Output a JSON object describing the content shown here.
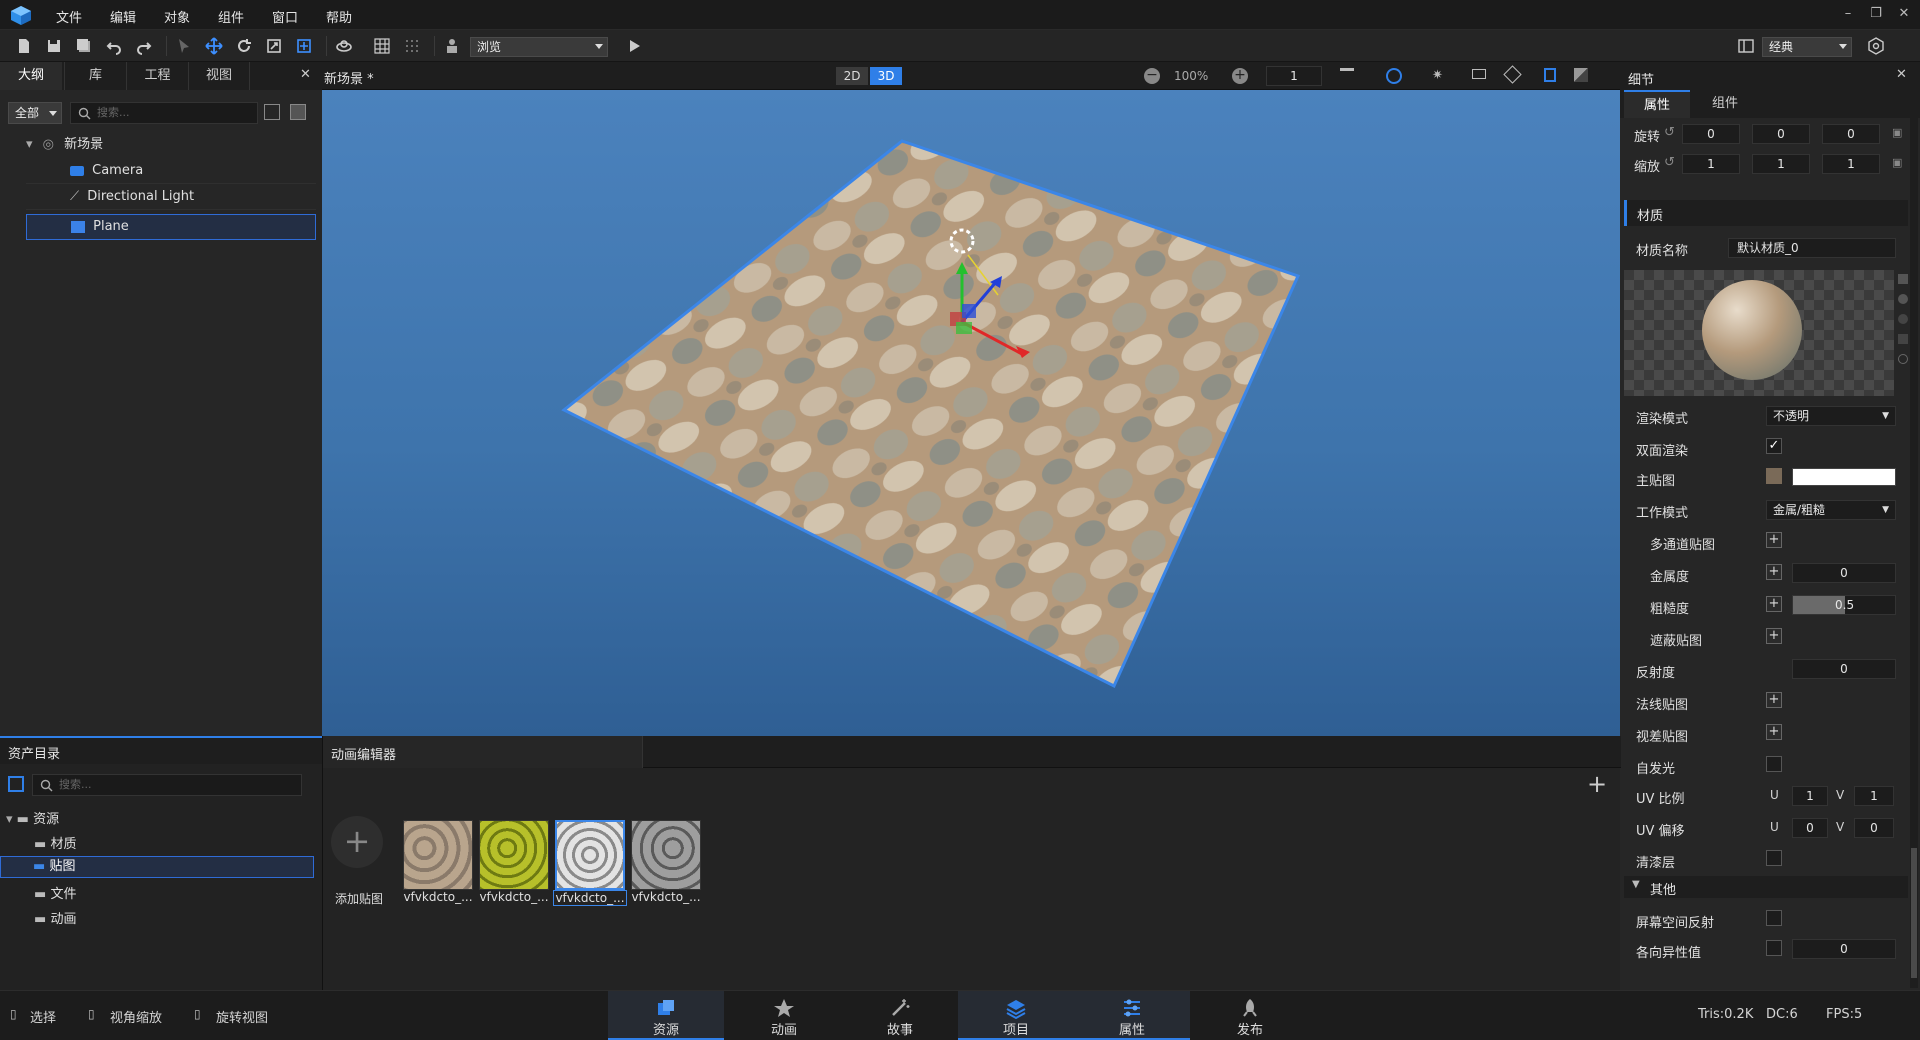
{
  "menu": [
    "文件",
    "编辑",
    "对象",
    "组件",
    "窗口",
    "帮助"
  ],
  "toolbar": {
    "mode_select": "浏览",
    "layout_select": "经典"
  },
  "outline": {
    "tabs": [
      "大纲",
      "库",
      "工程",
      "视图"
    ],
    "filter": "全部",
    "search_placeholder": "搜索...",
    "root": "新场景",
    "items": [
      "Camera",
      "Directional Light",
      "Plane"
    ]
  },
  "viewport": {
    "tab_title": "新场景 *",
    "mode_2d": "2D",
    "mode_3d": "3D",
    "zoom": "100%",
    "step": "1"
  },
  "details": {
    "title": "细节",
    "tabs": [
      "属性",
      "组件"
    ],
    "rotation_label": "旋转",
    "rotation": [
      "0",
      "0",
      "0"
    ],
    "scale_label": "缩放",
    "scale": [
      "1",
      "1",
      "1"
    ],
    "material_header": "材质",
    "material_name_label": "材质名称",
    "material_name": "默认材质_0",
    "render_mode_label": "渲染模式",
    "render_mode": "不透明",
    "double_side_label": "双面渲染",
    "main_map_label": "主贴图",
    "work_mode_label": "工作模式",
    "work_mode": "金属/粗糙",
    "multi_channel_label": "多通道贴图",
    "metalness_label": "金属度",
    "metalness": "0",
    "roughness_label": "粗糙度",
    "roughness": "0.5",
    "roughness_fraction": 0.5,
    "occlusion_label": "遮蔽贴图",
    "reflectivity_label": "反射度",
    "reflectivity": "0",
    "normal_map_label": "法线贴图",
    "parallax_map_label": "视差贴图",
    "emissive_label": "自发光",
    "uv_scale_label": "UV 比例",
    "uv_scale_u": "1",
    "uv_scale_v": "1",
    "uv_offset_label": "UV 偏移",
    "uv_offset_u": "0",
    "uv_offset_v": "0",
    "u": "U",
    "v": "V",
    "clearcoat_label": "清漆层",
    "other_header": "其他",
    "ssr_label": "屏幕空间反射",
    "anisotropy_label": "各向异性值",
    "anisotropy": "0"
  },
  "assets": {
    "title": "资产目录",
    "search_placeholder": "搜索...",
    "root": "资源",
    "folders": [
      "材质",
      "贴图",
      "文件",
      "动画"
    ],
    "add_label": "添加贴图",
    "thumbs": [
      "vfvkdcto_...",
      "vfvkdcto_...",
      "vfvkdcto_...",
      "vfvkdcto_..."
    ]
  },
  "anim_editor": {
    "title": "动画编辑器"
  },
  "status": {
    "hints": [
      "选择",
      "视角缩放",
      "旋转视图"
    ],
    "tabs": [
      "资源",
      "动画",
      "故事",
      "项目",
      "属性",
      "发布"
    ],
    "tris": "Tris:0.2K",
    "dc": "DC:6",
    "fps": "FPS:5"
  },
  "colors": {
    "accent": "#2f7fe8",
    "viewport_bg": "#3f77b0"
  }
}
